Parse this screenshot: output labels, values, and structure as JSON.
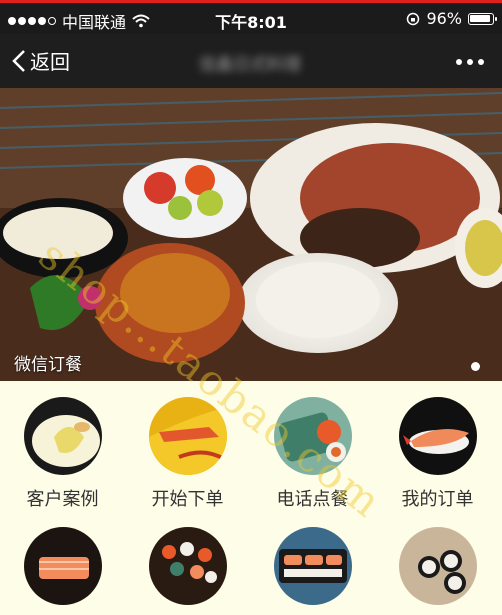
{
  "status_bar": {
    "carrier": "中国联通",
    "time": "下午8:01",
    "battery_text": "96%",
    "battery_level": 0.96
  },
  "nav": {
    "back_label": "返回",
    "title": "佳鑫日式料理"
  },
  "banner": {
    "caption": "微信订餐",
    "slides_count": 1,
    "active_slide": 1
  },
  "menu": [
    {
      "label": "客户案例",
      "icon": "tempura-plate"
    },
    {
      "label": "开始下单",
      "icon": "crab-plate"
    },
    {
      "label": "电话点餐",
      "icon": "sushi-rolls"
    },
    {
      "label": "我的订单",
      "icon": "shrimp-nigiri"
    },
    {
      "label": "",
      "icon": "salmon-sashimi"
    },
    {
      "label": "",
      "icon": "sushi-boat"
    },
    {
      "label": "",
      "icon": "salmon-sushi-tray"
    },
    {
      "label": "",
      "icon": "maki-plate"
    }
  ],
  "watermark": "shop...taobao.com",
  "colors": {
    "status_bg": "#1b1b1b",
    "nav_bg": "#1e1e1e",
    "accent_red": "#e0201d",
    "page_bg": "#fefee8"
  }
}
